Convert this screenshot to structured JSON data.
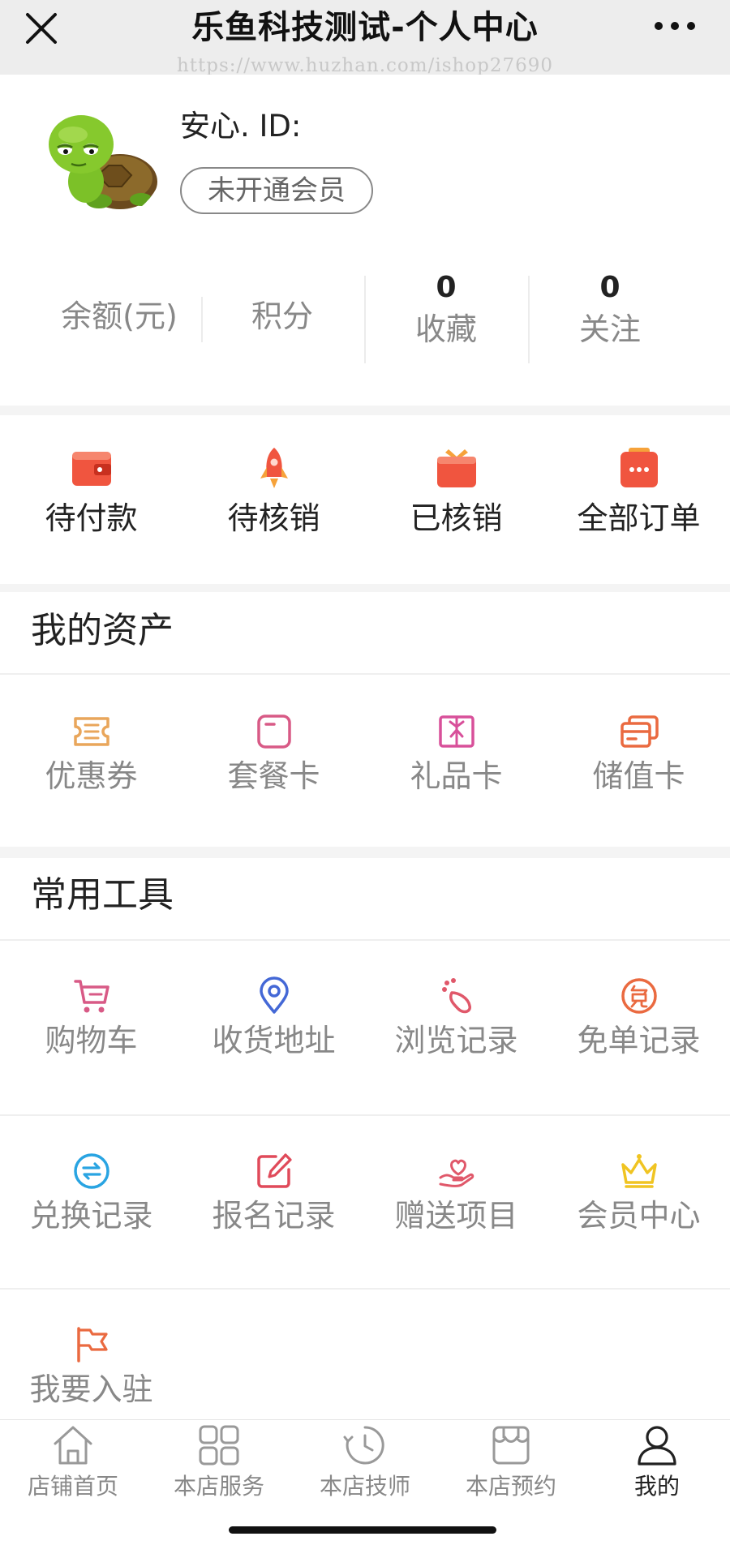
{
  "header": {
    "title": "乐鱼科技测试-个人中心",
    "watermark": "https://www.huzhan.com/ishop27690"
  },
  "profile": {
    "name": "安心. ID:",
    "member_status": "未开通会员",
    "stats": [
      {
        "label": "余额(元)"
      },
      {
        "label": "积分"
      },
      {
        "value": "0",
        "label": "收藏"
      },
      {
        "value": "0",
        "label": "关注"
      }
    ]
  },
  "orders": [
    {
      "label": "待付款",
      "icon": "wallet-icon"
    },
    {
      "label": "待核销",
      "icon": "rocket-icon"
    },
    {
      "label": "已核销",
      "icon": "gift-box-icon"
    },
    {
      "label": "全部订单",
      "icon": "order-list-icon"
    }
  ],
  "assets": {
    "title": "我的资产",
    "items": [
      {
        "label": "优惠券",
        "icon": "coupon-icon"
      },
      {
        "label": "套餐卡",
        "icon": "package-card-icon"
      },
      {
        "label": "礼品卡",
        "icon": "gift-card-icon"
      },
      {
        "label": "储值卡",
        "icon": "stored-value-card-icon"
      }
    ]
  },
  "tools": {
    "title": "常用工具",
    "items": [
      {
        "label": "购物车",
        "icon": "cart-icon"
      },
      {
        "label": "收货地址",
        "icon": "location-pin-icon"
      },
      {
        "label": "浏览记录",
        "icon": "footprint-icon"
      },
      {
        "label": "免单记录",
        "icon": "free-order-icon"
      },
      {
        "label": "兑换记录",
        "icon": "exchange-icon"
      },
      {
        "label": "报名记录",
        "icon": "edit-icon"
      },
      {
        "label": "赠送项目",
        "icon": "heart-hand-icon"
      },
      {
        "label": "会员中心",
        "icon": "crown-icon"
      },
      {
        "label": "我要入驻",
        "icon": "flag-icon"
      }
    ]
  },
  "tabbar": {
    "tabs": [
      {
        "label": "店铺首页",
        "icon": "home-icon"
      },
      {
        "label": "本店服务",
        "icon": "grid-icon"
      },
      {
        "label": "本店技师",
        "icon": "clock-icon"
      },
      {
        "label": "本店预约",
        "icon": "store-icon"
      },
      {
        "label": "我的",
        "icon": "user-icon",
        "active": true
      }
    ]
  },
  "colors": {
    "accent_red": "#f0553f",
    "coupon_orange": "#e9a65b",
    "pink": "#d85a86",
    "gift_pink": "#d8509a",
    "blue": "#4468d6",
    "cyan": "#29a4e2",
    "gold": "#f0c422"
  }
}
